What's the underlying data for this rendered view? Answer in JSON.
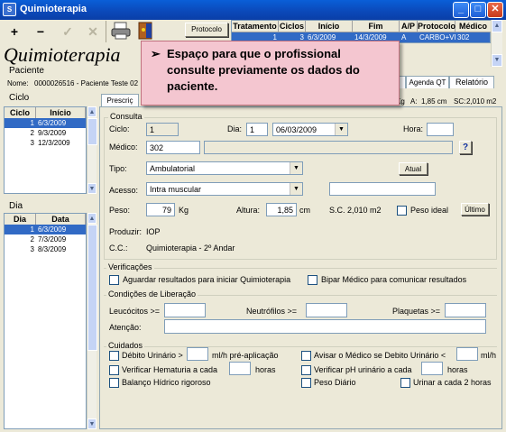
{
  "window": {
    "title": "Quimioterapia",
    "icon_text": "S"
  },
  "window_buttons": {
    "minimize": "_",
    "maximize": "□",
    "close": "✕"
  },
  "toolbar": {
    "add": "+",
    "remove": "−",
    "confirm": "✓",
    "cancel": "✕",
    "protocol_label": "Protocolo"
  },
  "treatment_grid": {
    "headers": [
      "Tratamento",
      "Ciclos",
      "Início",
      "Fim",
      "A/P",
      "Protocolo",
      "Médico"
    ],
    "rows": [
      [
        "1",
        "3",
        "6/3/2009",
        "14/3/2009",
        "A",
        "CARBO+VP",
        "302"
      ]
    ]
  },
  "page_title": "Quimioterapia",
  "patient": {
    "group_label": "Paciente",
    "name_label": "Nome:",
    "name_value": "0000026516 - Paciente Teste 02"
  },
  "right_tabs": [
    "o",
    "Agenda QT",
    "Relatório"
  ],
  "measures": {
    "kg_label": "Kg",
    "height_label": "A:",
    "height_value": "1,85 cm",
    "sc_label": "SC:",
    "sc_value": "2,010 m2"
  },
  "callout": {
    "arrow": "➢",
    "text": "Espaço para que o profissional consulte previamente os dados do paciente."
  },
  "ciclo": {
    "group_label": "Ciclo",
    "headers": [
      "Ciclo",
      "Início"
    ],
    "rows": [
      [
        "1",
        "6/3/2009"
      ],
      [
        "2",
        "9/3/2009"
      ],
      [
        "3",
        "12/3/2009"
      ]
    ]
  },
  "dia": {
    "group_label": "Dia",
    "headers": [
      "Dia",
      "Data"
    ],
    "rows": [
      [
        "1",
        "6/3/2009"
      ],
      [
        "2",
        "7/3/2009"
      ],
      [
        "3",
        "8/3/2009"
      ]
    ]
  },
  "prescription_tab": "Prescriç",
  "consulta": {
    "group_label": "Consulta",
    "ciclo_label": "Ciclo:",
    "ciclo_value": "1",
    "dia_label": "Dia:",
    "dia_value": "1",
    "date_value": "06/03/2009",
    "hora_label": "Hora:",
    "hora_value": "",
    "medico_label": "Médico:",
    "medico_value": "302",
    "medico_name": "",
    "help_button": "?",
    "tipo_label": "Tipo:",
    "tipo_value": "Ambulatorial",
    "atual_button": "Atual",
    "acesso_label": "Acesso:",
    "acesso_value": "Intra muscular",
    "acesso_extra": "",
    "peso_label": "Peso:",
    "peso_value": "79",
    "peso_unit": "Kg",
    "altura_label": "Altura:",
    "altura_value": "1,85",
    "altura_unit": "cm",
    "sc_text": "S.C. 2,010 m2",
    "peso_ideal_label": "Peso ideal",
    "ultimo_button": "Último",
    "produzir_label": "Produzir:",
    "produzir_value": "IOP",
    "cc_label": "C.C.:",
    "cc_value": "Quimioterapia - 2º Andar"
  },
  "verificacoes": {
    "group_label": "Verificações",
    "items": [
      "Aguardar resultados para iniciar Quimioterapia",
      "Bipar Médico para comunicar resultados"
    ]
  },
  "liberacao": {
    "group_label": "Condições de Liberação",
    "leucocitos_label": "Leucócitos >=",
    "neutrofilos_label": "Neutrófilos >=",
    "plaquetas_label": "Plaquetas >=",
    "atencao_label": "Atenção:"
  },
  "cuidados": {
    "group_label": "Cuidados",
    "debito_label": "Débito Urinário >",
    "debito_unit": "ml/h pré-aplicação",
    "avisar_label": "Avisar o Médico se Debito Urinário <",
    "avisar_unit": "ml/h",
    "hematuria_label": "Verificar Hematuria a cada",
    "hematuria_unit": "horas",
    "ph_label": "Verificar pH urinário a cada",
    "ph_unit": "horas",
    "balanco_label": "Balanço Hídrico rigoroso",
    "peso_diario_label": "Peso Diário",
    "urinar_label": "Urinar a cada 2 horas"
  },
  "scroll": {
    "up": "▲",
    "down": "▼"
  }
}
